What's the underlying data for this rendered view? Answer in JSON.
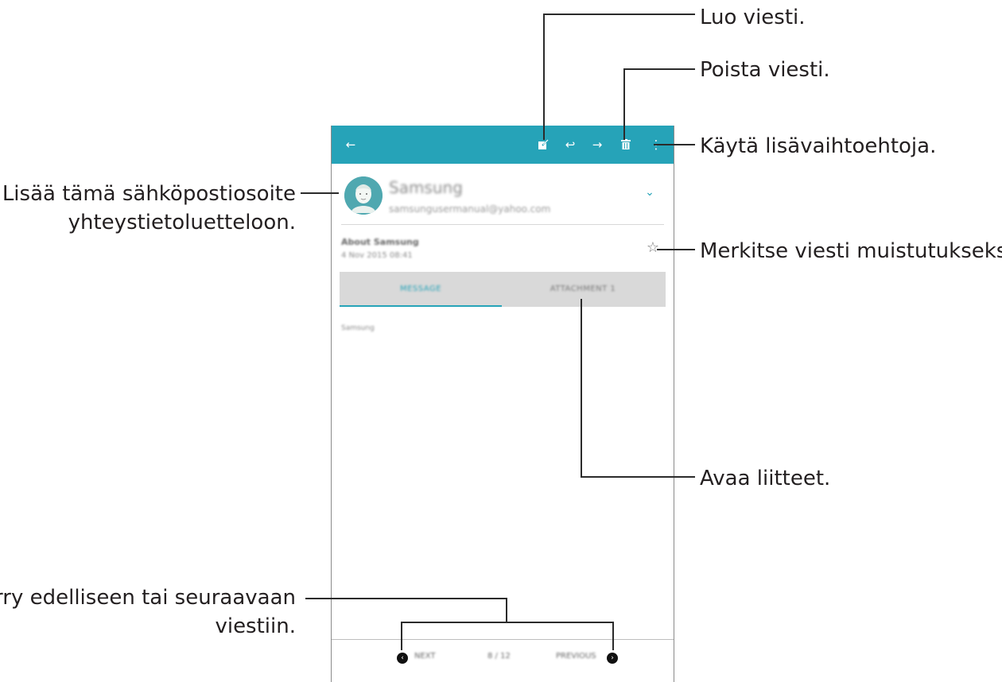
{
  "callouts": {
    "compose": "Luo viesti.",
    "delete": "Poista viesti.",
    "more": "Käytä lisävaihtoehtoja.",
    "add_contact_line1": "Lisää tämä sähköpostiosoite",
    "add_contact_line2": "yhteystietoluetteloon.",
    "favorite": "Merkitse viesti muistutukseksi.",
    "attachments": "Avaa liitteet.",
    "navigate_line1": "Siirry edelliseen tai seuraavaan",
    "navigate_line2": "viestiin."
  },
  "appbar": {
    "color": "#26a3b8",
    "icons": [
      "back-arrow-icon",
      "compose-icon",
      "reply-icon",
      "forward-icon",
      "trash-icon",
      "more-vert-icon"
    ]
  },
  "email": {
    "sender_name": "Samsung",
    "sender_email": "samsungusermanual@yahoo.com",
    "subject": "About Samsung",
    "date": "4 Nov 2015 08:41",
    "body": "Samsung"
  },
  "tabs": {
    "message": "MESSAGE",
    "attachment": "ATTACHMENT 1"
  },
  "bottom_nav": {
    "next": "NEXT",
    "page": "8 / 12",
    "previous": "PREVIOUS"
  }
}
